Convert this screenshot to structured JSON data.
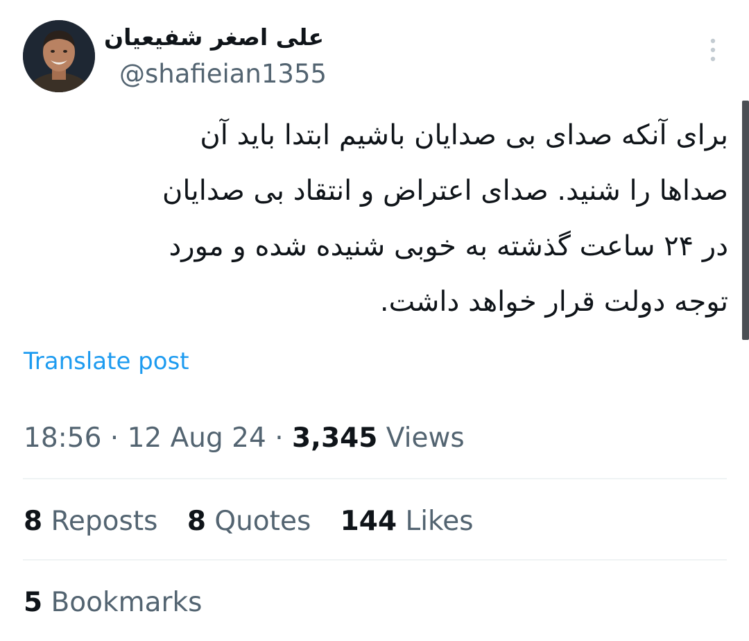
{
  "author": {
    "display_name": "علی اصغر شفیعیان",
    "handle": "@shafieian1355"
  },
  "tweet": {
    "lines": [
      "برای آنکه صدای بی صدایان باشیم ابتدا باید آن",
      "صداها را شنید. صدای اعتراض و انتقاد بی صدایان",
      "در ۲۴ ساعت گذشته به خوبی شنیده شده و مورد",
      "توجه دولت قرار خواهد داشت."
    ],
    "translate_label": "Translate post"
  },
  "meta": {
    "time": "18:56",
    "separator": " · ",
    "date": "12 Aug 24",
    "views_count": "3,345",
    "views_label": " Views"
  },
  "stats": {
    "reposts_count": "8",
    "reposts_label": " Reposts",
    "quotes_count": "8",
    "quotes_label": " Quotes",
    "likes_count": "144",
    "likes_label": " Likes",
    "bookmarks_count": "5",
    "bookmarks_label": " Bookmarks"
  },
  "icons": {
    "menu": "more-vertical-icon",
    "avatar": "profile-photo"
  },
  "colors": {
    "text": "#0f1419",
    "secondary": "#536471",
    "link": "#1d9bf0",
    "divider": "#eff3f4"
  }
}
